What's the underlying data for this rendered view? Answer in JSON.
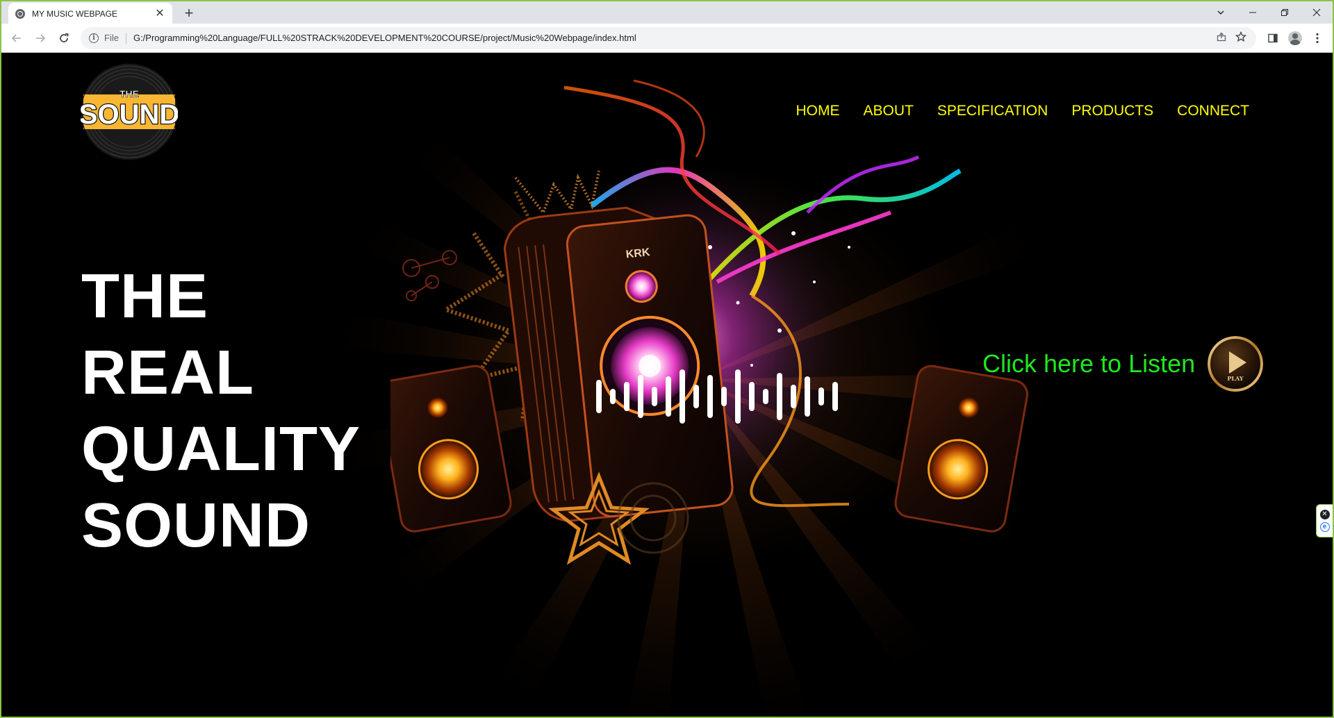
{
  "browser": {
    "tab": {
      "title": "MY MUSIC WEBPAGE",
      "close_glyph": "✕"
    },
    "new_tab_glyph": "+",
    "window_controls": {
      "minimize": "—",
      "maximize": "❐",
      "close": "✕",
      "tab_search": "⌄"
    },
    "address": {
      "scheme_label": "File",
      "url": "G:/Programming%20Language/FULL%20STRACK%20DEVELOPMENT%20COURSE/project/Music%20Webpage/index.html"
    },
    "icons": {
      "back": "back-arrow-icon",
      "forward": "forward-arrow-icon",
      "reload": "reload-icon",
      "share": "share-icon",
      "bookmark": "star-icon",
      "sidepanel": "side-panel-icon",
      "profile": "profile-icon",
      "menu": "kebab-menu-icon"
    }
  },
  "site": {
    "logo": {
      "top_text": "THE",
      "main_text": "SOUND"
    },
    "nav": [
      {
        "label": "HOME"
      },
      {
        "label": "ABOUT"
      },
      {
        "label": "SPECIFICATION"
      },
      {
        "label": "PRODUCTS"
      },
      {
        "label": "CONNECT"
      }
    ],
    "hero": {
      "lines": [
        "THE",
        "REAL",
        "QUALITY",
        "SOUND"
      ]
    },
    "listen": {
      "label": "Click here to Listen",
      "play_label": "PLAY"
    },
    "speaker_brand": "KRK",
    "colors": {
      "nav": "#ffff00",
      "listen": "#1fe81f",
      "hero": "#ffffff",
      "background": "#000000",
      "logo_yellow": "#f7b733",
      "window_border": "#8bc34a"
    }
  }
}
